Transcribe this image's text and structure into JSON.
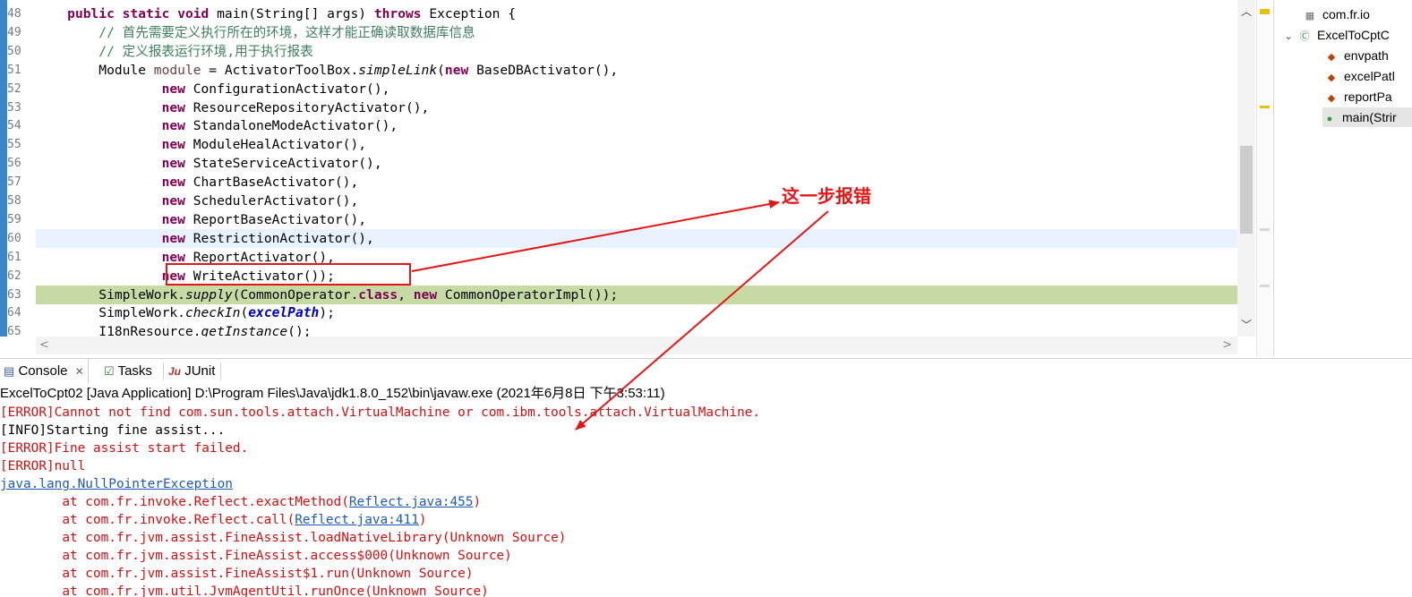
{
  "editor": {
    "lines": [
      {
        "num": "48",
        "tokens": [
          {
            "t": "    ",
            "c": ""
          },
          {
            "t": "public",
            "c": "kw"
          },
          {
            "t": " ",
            "c": ""
          },
          {
            "t": "static",
            "c": "kw"
          },
          {
            "t": " ",
            "c": ""
          },
          {
            "t": "void",
            "c": "kw"
          },
          {
            "t": " main(String[] args) ",
            "c": ""
          },
          {
            "t": "throws",
            "c": "kw"
          },
          {
            "t": " Exception {",
            "c": ""
          }
        ]
      },
      {
        "num": "49",
        "tokens": [
          {
            "t": "        // 首先需要定义执行所在的环境，这样才能正确读取数据库信息",
            "c": "cm"
          }
        ]
      },
      {
        "num": "50",
        "tokens": [
          {
            "t": "        // 定义报表运行环境,用于执行报表",
            "c": "cm"
          }
        ]
      },
      {
        "num": "51",
        "tokens": [
          {
            "t": "        Module ",
            "c": ""
          },
          {
            "t": "module",
            "c": "kw-var"
          },
          {
            "t": " = ActivatorToolBox.",
            "c": ""
          },
          {
            "t": "simpleLink",
            "c": "it"
          },
          {
            "t": "(",
            "c": ""
          },
          {
            "t": "new",
            "c": "kw"
          },
          {
            "t": " BaseDBActivator(),",
            "c": ""
          }
        ]
      },
      {
        "num": "52",
        "tokens": [
          {
            "t": "                ",
            "c": ""
          },
          {
            "t": "new",
            "c": "kw"
          },
          {
            "t": " ConfigurationActivator(),",
            "c": ""
          }
        ]
      },
      {
        "num": "53",
        "tokens": [
          {
            "t": "                ",
            "c": ""
          },
          {
            "t": "new",
            "c": "kw"
          },
          {
            "t": " ResourceRepositoryActivator(),",
            "c": ""
          }
        ]
      },
      {
        "num": "54",
        "tokens": [
          {
            "t": "                ",
            "c": ""
          },
          {
            "t": "new",
            "c": "kw"
          },
          {
            "t": " StandaloneModeActivator(),",
            "c": ""
          }
        ]
      },
      {
        "num": "55",
        "tokens": [
          {
            "t": "                ",
            "c": ""
          },
          {
            "t": "new",
            "c": "kw"
          },
          {
            "t": " ModuleHealActivator(),",
            "c": ""
          }
        ]
      },
      {
        "num": "56",
        "tokens": [
          {
            "t": "                ",
            "c": ""
          },
          {
            "t": "new",
            "c": "kw"
          },
          {
            "t": " StateServiceActivator(),",
            "c": ""
          }
        ]
      },
      {
        "num": "57",
        "tokens": [
          {
            "t": "                ",
            "c": ""
          },
          {
            "t": "new",
            "c": "kw"
          },
          {
            "t": " ChartBaseActivator(),",
            "c": ""
          }
        ]
      },
      {
        "num": "58",
        "tokens": [
          {
            "t": "                ",
            "c": ""
          },
          {
            "t": "new",
            "c": "kw"
          },
          {
            "t": " SchedulerActivator(),",
            "c": ""
          }
        ]
      },
      {
        "num": "59",
        "tokens": [
          {
            "t": "                ",
            "c": ""
          },
          {
            "t": "new",
            "c": "kw"
          },
          {
            "t": " ReportBaseActivator(),",
            "c": ""
          }
        ]
      },
      {
        "num": "60",
        "tokens": [
          {
            "t": "                ",
            "c": ""
          },
          {
            "t": "new",
            "c": "kw"
          },
          {
            "t": " RestrictionActivator(),",
            "c": ""
          }
        ]
      },
      {
        "num": "61",
        "tokens": [
          {
            "t": "                ",
            "c": ""
          },
          {
            "t": "new",
            "c": "kw"
          },
          {
            "t": " ReportActivator(),",
            "c": ""
          }
        ]
      },
      {
        "num": "62",
        "tokens": [
          {
            "t": "                ",
            "c": ""
          },
          {
            "t": "new",
            "c": "kw"
          },
          {
            "t": " WriteActivator());",
            "c": ""
          }
        ]
      },
      {
        "num": "63",
        "tokens": [
          {
            "t": "        SimpleWork.",
            "c": ""
          },
          {
            "t": "supply",
            "c": "it"
          },
          {
            "t": "(CommonOperator.",
            "c": ""
          },
          {
            "t": "class",
            "c": "kw"
          },
          {
            "t": ", ",
            "c": ""
          },
          {
            "t": "new",
            "c": "kw"
          },
          {
            "t": " CommonOperatorImpl());",
            "c": ""
          }
        ]
      },
      {
        "num": "64",
        "tokens": [
          {
            "t": "        SimpleWork.",
            "c": ""
          },
          {
            "t": "checkIn",
            "c": "it"
          },
          {
            "t": "(",
            "c": ""
          },
          {
            "t": "excelPath",
            "c": "fd"
          },
          {
            "t": ");",
            "c": ""
          }
        ]
      },
      {
        "num": "65",
        "tokens": [
          {
            "t": "        I18nResource.",
            "c": ""
          },
          {
            "t": "getInstance",
            "c": "it"
          },
          {
            "t": "();",
            "c": ""
          }
        ]
      }
    ]
  },
  "outline": {
    "items": [
      {
        "label": "com.fr.io",
        "icon": "import-icon"
      },
      {
        "label": "ExcelToCptC",
        "icon": "class-icon"
      },
      {
        "label": "envpath",
        "icon": "field-icon"
      },
      {
        "label": "excelPatl",
        "icon": "field-icon"
      },
      {
        "label": "reportPa",
        "icon": "field-icon"
      },
      {
        "label": "main(Strir",
        "icon": "method-icon"
      }
    ]
  },
  "tabs": {
    "console": "Console",
    "tasks": "Tasks",
    "junit": "JUnit"
  },
  "console": {
    "description": "ExcelToCpt02 [Java Application] D:\\Program Files\\Java\\jdk1.8.0_152\\bin\\javaw.exe (2021年6月8日 下午3:53:11)",
    "lines": {
      "l1": "[ERROR]Cannot not find com.sun.tools.attach.VirtualMachine or com.ibm.tools.attach.VirtualMachine.",
      "l2": "[INFO]Starting fine assist...",
      "l3": "[ERROR]Fine assist start failed.",
      "l4": "[ERROR]null",
      "l5": "java.lang.NullPointerException",
      "l6a": "\tat com.fr.invoke.Reflect.exactMethod(",
      "l6link": "Reflect.java:455",
      "l7a": "\tat com.fr.invoke.Reflect.call(",
      "l7link": "Reflect.java:411",
      "l8": "\tat com.fr.jvm.assist.FineAssist.loadNativeLibrary(Unknown Source)",
      "l9": "\tat com.fr.jvm.assist.FineAssist.access$000(Unknown Source)",
      "l10": "\tat com.fr.jvm.assist.FineAssist$1.run(Unknown Source)",
      "l11": "\tat com.fr.jvm.util.JvmAgentUtil.runOnce(Unknown Source)"
    }
  },
  "annotation": {
    "callout": "这一步报错",
    "color": "#e51515"
  },
  "colors": {
    "keyword": "#7f0055",
    "comment": "#3f7f5f",
    "error": "#d01010",
    "link": "#1d5ab6"
  }
}
